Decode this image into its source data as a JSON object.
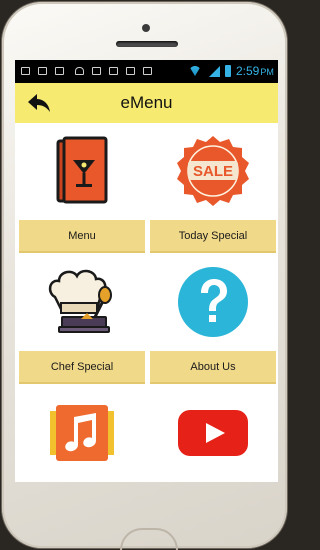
{
  "status_bar": {
    "time": "2:59",
    "ampm": "PM",
    "left_icons": [
      "image-icon",
      "message-icon",
      "mail-icon",
      "usb-icon",
      "check-icon",
      "camera-icon",
      "bag-icon",
      "grid-icon"
    ],
    "accent": "#35b3e6"
  },
  "app_bar": {
    "title": "eMenu",
    "back_icon": "back-arrow-icon",
    "background": "#f7ea70"
  },
  "tiles": [
    {
      "label": "Menu",
      "icon": "menu-book-icon"
    },
    {
      "label": "Today Special",
      "icon": "sale-badge-icon"
    },
    {
      "label": "Chef Special",
      "icon": "chef-hat-icon"
    },
    {
      "label": "About Us",
      "icon": "question-icon"
    },
    {
      "label": "",
      "icon": "music-icon"
    },
    {
      "label": "",
      "icon": "youtube-play-icon"
    }
  ],
  "colors": {
    "tile_label_bg": "#f1d98a",
    "menu_book": "#e8582b",
    "sale_badge": "#e8582b",
    "question": "#2bb5d8",
    "music": "#ef6a2e",
    "youtube": "#e62117"
  }
}
